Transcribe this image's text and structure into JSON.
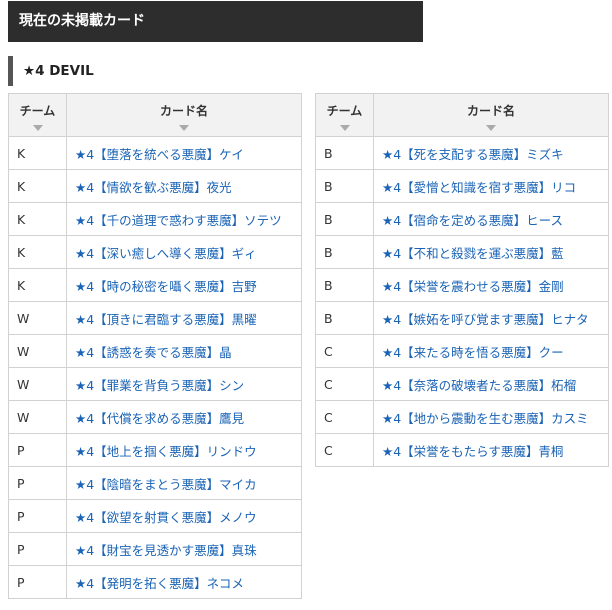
{
  "page": {
    "title": "現在の未掲載カード",
    "subheading": "★4 DEVIL"
  },
  "table_headers": {
    "team": "チーム",
    "card": "カード名"
  },
  "left_table": [
    {
      "team": "K",
      "card": "★4【堕落を統べる悪魔】ケイ"
    },
    {
      "team": "K",
      "card": "★4【情欲を歓ぶ悪魔】夜光"
    },
    {
      "team": "K",
      "card": "★4【千の道理で惑わす悪魔】ソテツ"
    },
    {
      "team": "K",
      "card": "★4【深い癒しへ導く悪魔】ギィ"
    },
    {
      "team": "K",
      "card": "★4【時の秘密を囁く悪魔】吉野"
    },
    {
      "team": "W",
      "card": "★4【頂きに君臨する悪魔】黒曜"
    },
    {
      "team": "W",
      "card": "★4【誘惑を奏でる悪魔】晶"
    },
    {
      "team": "W",
      "card": "★4【罪業を背負う悪魔】シン"
    },
    {
      "team": "W",
      "card": "★4【代償を求める悪魔】鷹見"
    },
    {
      "team": "P",
      "card": "★4【地上を掴く悪魔】リンドウ"
    },
    {
      "team": "P",
      "card": "★4【陰暗をまとう悪魔】マイカ"
    },
    {
      "team": "P",
      "card": "★4【欲望を射貫く悪魔】メノウ"
    },
    {
      "team": "P",
      "card": "★4【財宝を見透かす悪魔】真珠"
    },
    {
      "team": "P",
      "card": "★4【発明を拓く悪魔】ネコメ"
    }
  ],
  "right_table": [
    {
      "team": "B",
      "card": "★4【死を支配する悪魔】ミズキ"
    },
    {
      "team": "B",
      "card": "★4【愛憎と知識を宿す悪魔】リコ"
    },
    {
      "team": "B",
      "card": "★4【宿命を定める悪魔】ヒース"
    },
    {
      "team": "B",
      "card": "★4【不和と殺戮を運ぶ悪魔】藍"
    },
    {
      "team": "B",
      "card": "★4【栄誉を震わせる悪魔】金剛"
    },
    {
      "team": "B",
      "card": "★4【嫉妬を呼び覚ます悪魔】ヒナタ"
    },
    {
      "team": "C",
      "card": "★4【来たる時を悟る悪魔】クー"
    },
    {
      "team": "C",
      "card": "★4【奈落の破壊者たる悪魔】柘榴"
    },
    {
      "team": "C",
      "card": "★4【地から震動を生む悪魔】カスミ"
    },
    {
      "team": "C",
      "card": "★4【栄誉をもたらす悪魔】青桐"
    }
  ],
  "colors": {
    "title_bg": "#2d2d2d",
    "link": "#1a63b5",
    "header_bg": "#f2f2f2"
  },
  "icons": {
    "sort": "sort-arrow-down-icon"
  }
}
